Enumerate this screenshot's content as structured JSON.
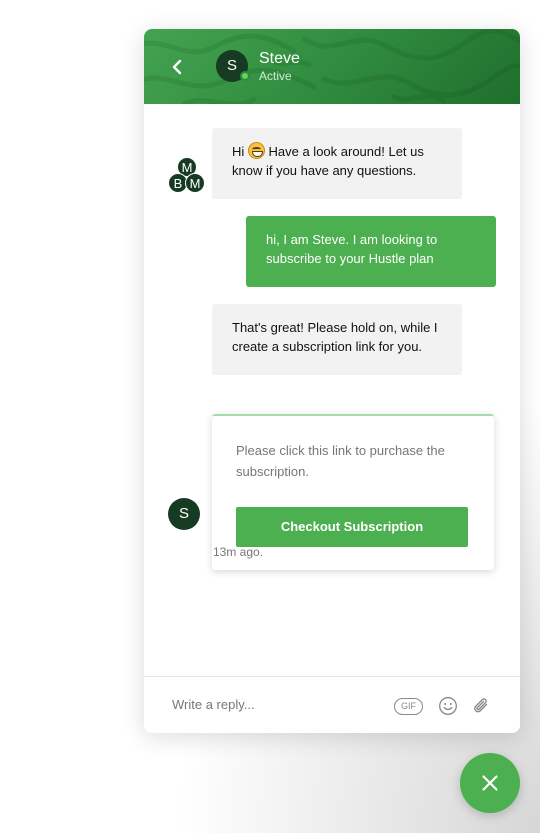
{
  "colors": {
    "accent": "#4caf50",
    "header_dark": "#1f6e2d",
    "avatar": "#163b22",
    "online": "#62d456",
    "incoming_bubble": "#f2f2f2"
  },
  "header": {
    "back_icon": "chevron-left-icon",
    "avatar_initial": "S",
    "name": "Steve",
    "status": "Active"
  },
  "conversation": {
    "bot_avatar_initials": [
      "M",
      "B",
      "M"
    ],
    "messages": [
      {
        "from": "bot",
        "text_before_emoji": "Hi ",
        "emoji": "grinning-face-emoji",
        "text_after_emoji": " Have a look around! Let us know if you have any questions."
      },
      {
        "from": "user",
        "text": "hi, I am Steve. I am looking to subscribe to your Hustle plan"
      },
      {
        "from": "bot",
        "text": "That's great! Please hold on, while I create a subscription link for you."
      }
    ],
    "card": {
      "text": "Please click this link to purchase the subscription.",
      "button_label": "Checkout Subscription"
    },
    "agent_avatar_initial": "S",
    "timestamp": "13m ago."
  },
  "composer": {
    "placeholder": "Write a reply...",
    "gif_label": "GIF",
    "emoji_icon": "smiley-icon",
    "attach_icon": "paperclip-icon"
  },
  "launcher": {
    "icon": "close-icon"
  }
}
